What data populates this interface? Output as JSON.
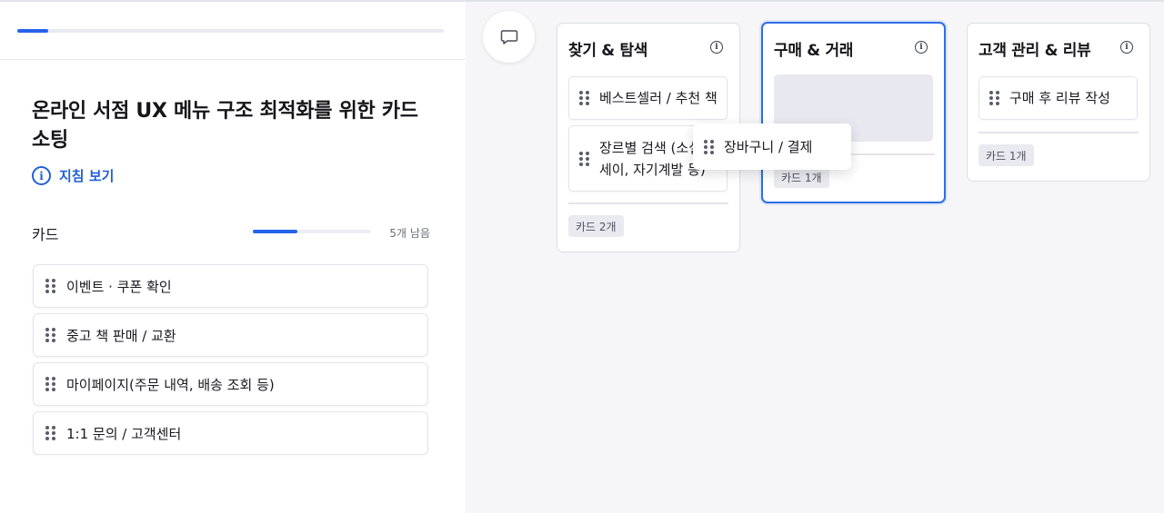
{
  "header": {
    "progress_fraction": 0.072
  },
  "sort": {
    "title": "온라인 서점 UX 메뉴 구조 최적화를 위한 카드 소팅",
    "guide_link": "지침 보기",
    "cards_label": "카드",
    "cards_progress_fraction": 0.38,
    "remaining_text": "5개 남음"
  },
  "pool": {
    "cards": [
      {
        "label": "이벤트 · 쿠폰 확인"
      },
      {
        "label": "중고 책 판매 / 교환"
      },
      {
        "label": "마이페이지(주문 내역, 배송 조회 등)"
      },
      {
        "label": "1:1 문의 / 고객센터"
      }
    ]
  },
  "board": {
    "columns": [
      {
        "title": "찾기 & 탐색",
        "cards": [
          {
            "label": "베스트셀러 / 추천 책"
          },
          {
            "label_line1": "장르별 검색 (소설, 에",
            "label_line2": "세이, 자기계발 등)"
          }
        ],
        "count_label": "카드 2개"
      },
      {
        "title": "구매 & 거래",
        "cards": [],
        "count_label": "카드 1개"
      },
      {
        "title": "고객 관리 & 리뷰",
        "cards": [
          {
            "label": "구매 후 리뷰 작성"
          }
        ],
        "count_label": "카드 1개"
      }
    ],
    "dragging_card": {
      "label": "장바구니 / 결제"
    }
  },
  "icons": {
    "info": "info-icon",
    "comment": "comment-icon",
    "drag_handle": "drag-handle-icon"
  },
  "colors": {
    "accent": "#2563eb",
    "link": "#1f5fd6"
  }
}
